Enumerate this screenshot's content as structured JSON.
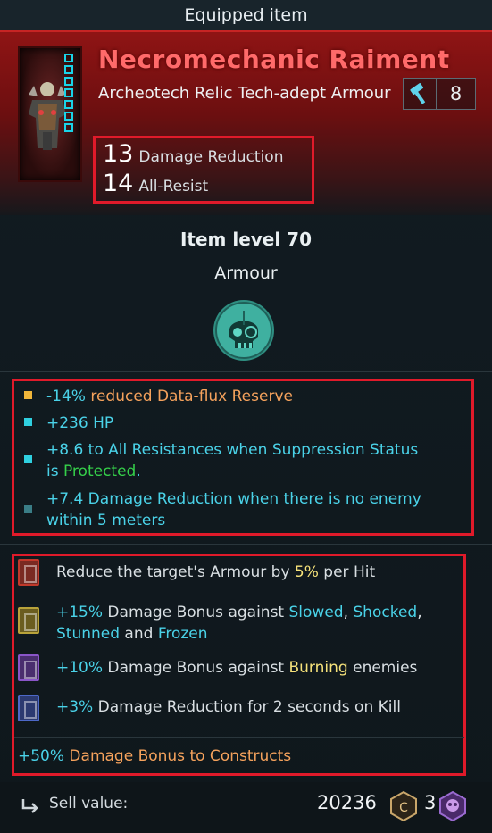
{
  "topbar": {
    "title": "Equipped item"
  },
  "item": {
    "name": "Necromechanic Raiment",
    "subtitle": "Archeotech Relic Tech-adept Armour",
    "tech_level": "8",
    "icon": "armour-portrait"
  },
  "base_stats": [
    {
      "value": "13",
      "label": "Damage Reduction"
    },
    {
      "value": "14",
      "label": "All-Resist"
    }
  ],
  "item_level": "Item level 70",
  "item_type": "Armour",
  "attributes": [
    {
      "color": "#f0b63a",
      "parts": [
        "-14%",
        " reduced Data-flux Reserve"
      ]
    },
    {
      "color": "#2fd0e0",
      "parts": [
        "+236 HP"
      ]
    },
    {
      "color": "#2fd0e0",
      "parts": [
        "+8.6 to All Resistances when Suppression Status",
        "is ",
        "Protected",
        "."
      ]
    },
    {
      "color": "#3a7d86",
      "parts": [
        "+7.4 Damage Reduction when there is no enemy",
        "within 5 meters"
      ]
    }
  ],
  "perks": [
    {
      "icon_color": "#c0392b",
      "text_a": "Reduce the target's Armour by ",
      "hl": "5%",
      "text_b": " per Hit"
    },
    {
      "icon_color": "#b8a23a",
      "text_a": "+15%",
      "text_b": " Damage Bonus against ",
      "k1": "Slowed",
      "sep1": ", ",
      "k2": "Shocked",
      "sep2": ",",
      "k3": "Stunned",
      "sep3": " and ",
      "k4": "Frozen"
    },
    {
      "icon_color": "#8a55c8",
      "text_a": "+10%",
      "text_b": " Damage Bonus against ",
      "hl": "Burning",
      "text_c": " enemies"
    },
    {
      "icon_color": "#4d68c8",
      "text_a": "+3%",
      "text_b": " Damage Reduction for 2 seconds on Kill"
    }
  ],
  "construct_bonus": {
    "pct": "+50%",
    "text": " Damage Bonus to Constructs"
  },
  "footer": {
    "sell_label": "Sell value:",
    "sell_value": "20236",
    "gem_count": "3"
  },
  "colors": {
    "accent_red": "#e01a2a",
    "header_red": "#8f1414",
    "cyan": "#4ad2e8",
    "orange": "#f5a25c"
  }
}
